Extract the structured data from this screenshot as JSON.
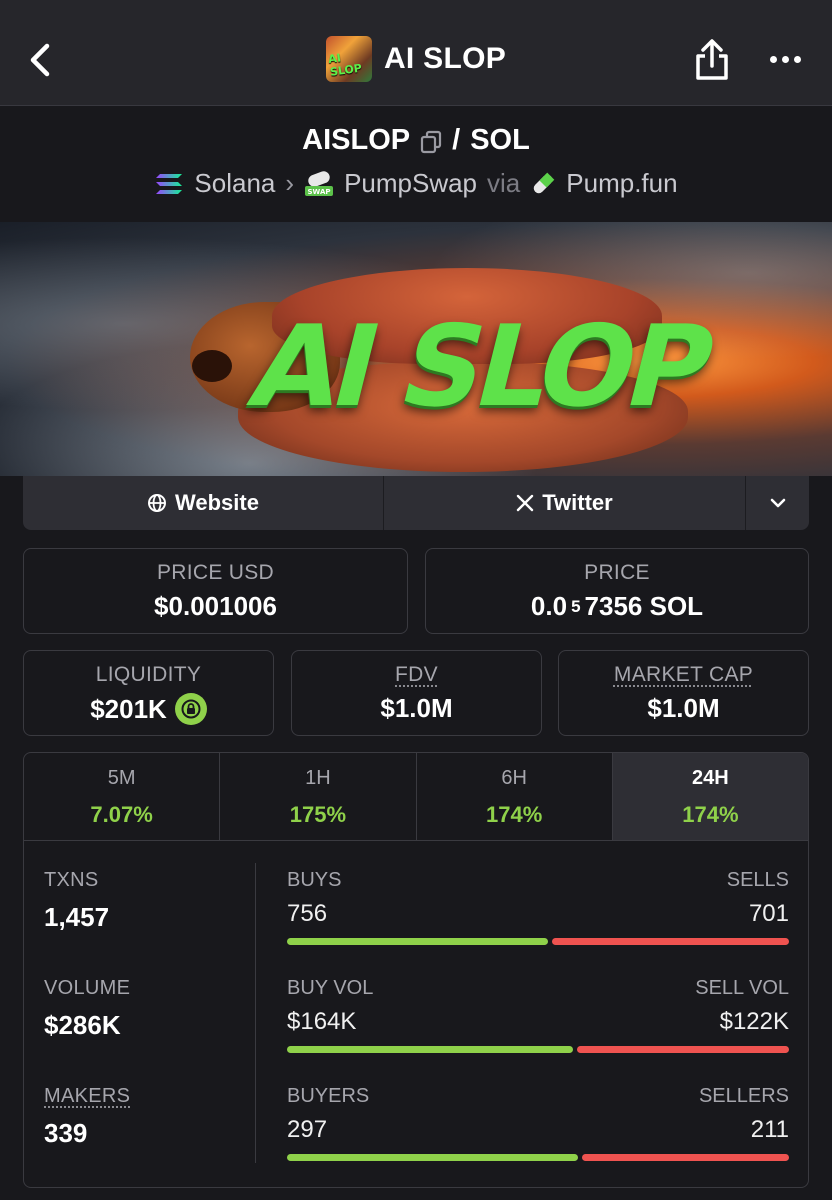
{
  "header": {
    "title": "AI SLOP",
    "logo_text": "AI SLOP",
    "back_icon": "chevron-left-icon",
    "share_icon": "share-icon",
    "more_icon": "more-icon"
  },
  "pair": {
    "base": "AISLOP",
    "separator": "/",
    "quote": "SOL",
    "chain": "Solana",
    "dex": "PumpSwap",
    "via": "via",
    "launchpad": "Pump.fun"
  },
  "banner": {
    "text": "AI SLOP"
  },
  "links": {
    "website": "Website",
    "twitter": "Twitter"
  },
  "prices": {
    "price_usd_label": "PRICE USD",
    "price_usd": "$0.001006",
    "price_label": "PRICE",
    "price_prefix": "0.0",
    "price_zeros": "5",
    "price_suffix": "7356 SOL"
  },
  "metrics": {
    "liquidity_label": "LIQUIDITY",
    "liquidity": "$201K",
    "fdv_label": "FDV",
    "fdv": "$1.0M",
    "mcap_label": "MARKET CAP",
    "mcap": "$1.0M"
  },
  "timeframes": [
    {
      "label": "5M",
      "change": "7.07%"
    },
    {
      "label": "1H",
      "change": "175%"
    },
    {
      "label": "6H",
      "change": "174%"
    },
    {
      "label": "24H",
      "change": "174%",
      "active": true
    }
  ],
  "stats": {
    "txns_label": "TXNS",
    "txns": "1,457",
    "volume_label": "VOLUME",
    "volume": "$286K",
    "makers_label": "MAKERS",
    "makers": "339",
    "buys_label": "BUYS",
    "buys": "756",
    "sells_label": "SELLS",
    "sells": "701",
    "buy_vol_label": "BUY VOL",
    "buy_vol": "$164K",
    "sell_vol_label": "SELL VOL",
    "sell_vol": "$122K",
    "buyers_label": "BUYERS",
    "buyers": "297",
    "sellers_label": "SELLERS",
    "sellers": "211",
    "buys_fraction": 0.52,
    "buy_vol_fraction": 0.57,
    "buyers_fraction": 0.58
  },
  "colors": {
    "background": "#18181c",
    "positive": "#8fd14a",
    "negative": "#ef5350"
  }
}
